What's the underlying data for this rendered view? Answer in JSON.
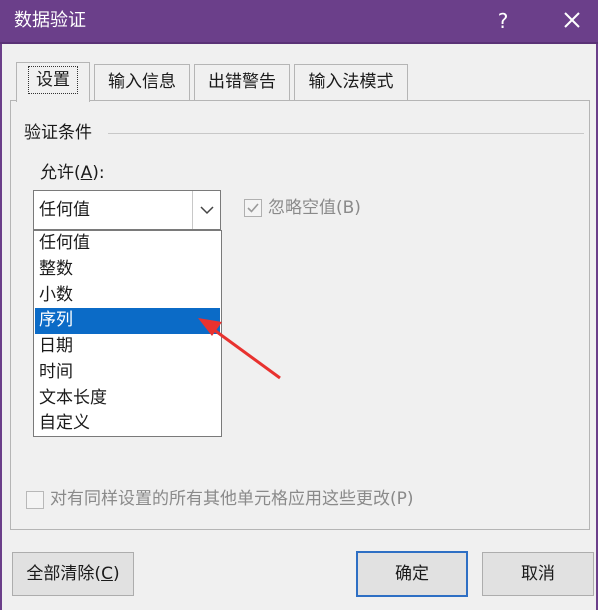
{
  "window": {
    "title": "数据验证",
    "help_label": "?",
    "accent_color": "#6b3f8a"
  },
  "tabs": [
    {
      "label": "设置",
      "active": true
    },
    {
      "label": "输入信息",
      "active": false
    },
    {
      "label": "出错警告",
      "active": false
    },
    {
      "label": "输入法模式",
      "active": false
    }
  ],
  "settings": {
    "section_title": "验证条件",
    "allow_label_prefix": "允许(",
    "allow_label_key": "A",
    "allow_label_suffix": "):",
    "allow_value": "任何值",
    "dropdown_items": [
      "任何值",
      "整数",
      "小数",
      "序列",
      "日期",
      "时间",
      "文本长度",
      "自定义"
    ],
    "selected_item": "序列",
    "ignore_blank_label": "忽略空值(B)",
    "ignore_blank_checked": true,
    "ignore_blank_enabled": false,
    "apply_all_label": "对有同样设置的所有其他单元格应用这些更改(P)",
    "apply_all_checked": false,
    "apply_all_enabled": false
  },
  "buttons": {
    "clear_all_prefix": "全部清除(",
    "clear_all_key": "C",
    "clear_all_suffix": ")",
    "ok": "确定",
    "cancel": "取消"
  },
  "annotation": {
    "arrow_color": "#e8322f",
    "points_to": "序列"
  }
}
